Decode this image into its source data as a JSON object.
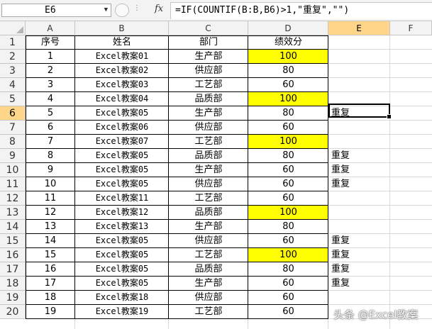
{
  "formula_bar": {
    "name_box": "E6",
    "fx_label": "fx",
    "formula": "=IF(COUNTIF(B:B,B6)>1,\"重复\",\"\")"
  },
  "columns": [
    "A",
    "B",
    "C",
    "D",
    "E",
    "F"
  ],
  "selected_column": "E",
  "selected_row": "6",
  "rows": [
    "1",
    "2",
    "3",
    "4",
    "5",
    "6",
    "7",
    "8",
    "9",
    "10",
    "11",
    "12",
    "13",
    "14",
    "15",
    "16",
    "17",
    "18",
    "19",
    "20"
  ],
  "header": {
    "a": "序号",
    "b": "姓名",
    "c": "部门",
    "d": "绩效分"
  },
  "table": [
    {
      "seq": "1",
      "name": "Excel教案01",
      "dept": "生产部",
      "score": "100",
      "hl": true,
      "dup": ""
    },
    {
      "seq": "2",
      "name": "Excel教案02",
      "dept": "供应部",
      "score": "80",
      "hl": false,
      "dup": ""
    },
    {
      "seq": "3",
      "name": "Excel教案03",
      "dept": "工艺部",
      "score": "60",
      "hl": false,
      "dup": ""
    },
    {
      "seq": "4",
      "name": "Excel教案04",
      "dept": "品质部",
      "score": "100",
      "hl": true,
      "dup": ""
    },
    {
      "seq": "5",
      "name": "Excel教案05",
      "dept": "生产部",
      "score": "80",
      "hl": false,
      "dup": "重复"
    },
    {
      "seq": "6",
      "name": "Excel教案06",
      "dept": "供应部",
      "score": "60",
      "hl": false,
      "dup": ""
    },
    {
      "seq": "7",
      "name": "Excel教案07",
      "dept": "工艺部",
      "score": "100",
      "hl": true,
      "dup": ""
    },
    {
      "seq": "8",
      "name": "Excel教案05",
      "dept": "品质部",
      "score": "80",
      "hl": false,
      "dup": "重复"
    },
    {
      "seq": "9",
      "name": "Excel教案05",
      "dept": "生产部",
      "score": "60",
      "hl": false,
      "dup": "重复"
    },
    {
      "seq": "10",
      "name": "Excel教案05",
      "dept": "供应部",
      "score": "60",
      "hl": false,
      "dup": "重复"
    },
    {
      "seq": "11",
      "name": "Excel教案11",
      "dept": "工艺部",
      "score": "60",
      "hl": false,
      "dup": ""
    },
    {
      "seq": "12",
      "name": "Excel教案12",
      "dept": "品质部",
      "score": "100",
      "hl": true,
      "dup": ""
    },
    {
      "seq": "13",
      "name": "Excel教案13",
      "dept": "生产部",
      "score": "80",
      "hl": false,
      "dup": ""
    },
    {
      "seq": "14",
      "name": "Excel教案05",
      "dept": "供应部",
      "score": "60",
      "hl": false,
      "dup": "重复"
    },
    {
      "seq": "15",
      "name": "Excel教案05",
      "dept": "工艺部",
      "score": "100",
      "hl": true,
      "dup": "重复"
    },
    {
      "seq": "16",
      "name": "Excel教案05",
      "dept": "品质部",
      "score": "80",
      "hl": false,
      "dup": "重复"
    },
    {
      "seq": "17",
      "name": "Excel教案05",
      "dept": "生产部",
      "score": "60",
      "hl": false,
      "dup": "重复"
    },
    {
      "seq": "18",
      "name": "Excel教案18",
      "dept": "供应部",
      "score": "60",
      "hl": false,
      "dup": ""
    },
    {
      "seq": "19",
      "name": "Excel教案19",
      "dept": "工艺部",
      "score": "60",
      "hl": false,
      "dup": ""
    }
  ],
  "highlight_color": "#ffff00",
  "watermark": "头条 @Excel教案"
}
